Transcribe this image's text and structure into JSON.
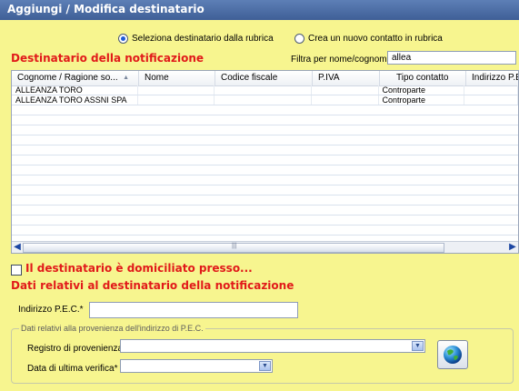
{
  "window": {
    "title": "Aggiungi / Modifica destinatario"
  },
  "options": {
    "select_from_rubrica": "Seleziona destinatario dalla rubrica",
    "create_new_contact": "Crea un nuovo contatto in rubrica",
    "selected": "select_from_rubrica"
  },
  "section_titles": {
    "notification_recipient": "Destinatario della notificazione",
    "domiciled": "Il destinatario è domiciliato presso...",
    "recipient_data": "Dati relativi al destinatario della notificazione"
  },
  "filter": {
    "label": "Filtra per nome/cognome",
    "value": "allea"
  },
  "grid": {
    "columns": [
      "Cognome / Ragione so...",
      "Nome",
      "Codice fiscale",
      "P.IVA",
      "Tipo contatto",
      "Indirizzo P.E.C"
    ],
    "rows": [
      [
        "ALLEANZA TORO",
        "",
        "",
        "",
        "Controparte",
        ""
      ],
      [
        "ALLEANZA TORO ASSNI SPA",
        "",
        "",
        "",
        "Controparte",
        ""
      ]
    ],
    "sort_indicator": "▲"
  },
  "pec": {
    "label": "Indirizzo P.E.C.*",
    "value": ""
  },
  "provenienza": {
    "legend": "Dati relativi alla provenienza dell'indirizzo di P.E.C.",
    "registro_label": "Registro di provenienza*",
    "registro_value": "",
    "data_label": "Data di ultima verifica*",
    "data_value": ""
  },
  "icons": {
    "globe": "globe-icon",
    "dropdown": "chevron-down-icon"
  },
  "colors": {
    "background": "#f7f58f",
    "section_red": "#e11a1a",
    "title_bar": "#4a6aa4"
  }
}
